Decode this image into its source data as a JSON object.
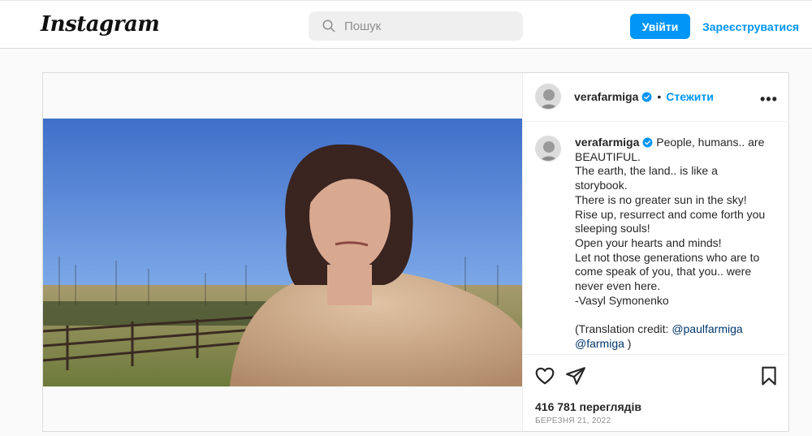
{
  "header": {
    "logo": "Instagram",
    "search_placeholder": "Пошук",
    "login_label": "Увійти",
    "signup_label": "Зареєструватися"
  },
  "post": {
    "username": "verafarmiga",
    "follow_label": "Стежити",
    "more_icon": "more-horizontal-icon",
    "caption": {
      "lines": [
        "People, humans.. are",
        "BEAUTIFUL.",
        "The earth, the land.. is like a",
        "storybook.",
        "There is no greater sun in the sky!",
        "Rise up, resurrect and come forth you",
        "sleeping souls!",
        "Open your hearts and minds!",
        "Let not those generations who are to",
        "come speak of you, that you.. were",
        "never even here.",
        "-Vasyl Symonenko",
        "",
        "(Translation credit: ",
        ""
      ],
      "mention_1": "@paulfarmiga",
      "mention_2": "@farmiga",
      "closing": " )"
    },
    "views": "416 781 переглядів",
    "date": "березня 21, 2022"
  },
  "colors": {
    "accent": "#0095f6",
    "mention": "#00376b",
    "verified": "#0095f6"
  }
}
